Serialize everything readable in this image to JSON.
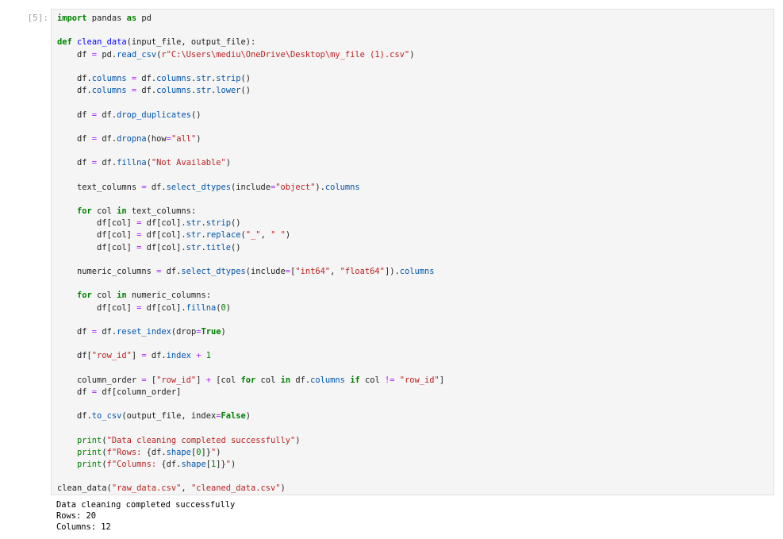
{
  "cell": {
    "prompt": "[5]:",
    "code_lines": [
      [
        {
          "t": "import",
          "c": "kw"
        },
        {
          "t": " pandas "
        },
        {
          "t": "as",
          "c": "kw"
        },
        {
          "t": " pd"
        }
      ],
      [],
      [
        {
          "t": "def",
          "c": "kw"
        },
        {
          "t": " "
        },
        {
          "t": "clean_data",
          "c": "fn"
        },
        {
          "t": "(input_file, output_file):"
        }
      ],
      [
        {
          "t": "    df "
        },
        {
          "t": "=",
          "c": "op"
        },
        {
          "t": " pd."
        },
        {
          "t": "read_csv",
          "c": "attr"
        },
        {
          "t": "("
        },
        {
          "t": "r\"C:\\Users\\mediu\\OneDrive\\Desktop\\my_file (1).csv\"",
          "c": "st"
        },
        {
          "t": ")"
        }
      ],
      [],
      [
        {
          "t": "    df."
        },
        {
          "t": "columns",
          "c": "attr"
        },
        {
          "t": " "
        },
        {
          "t": "=",
          "c": "op"
        },
        {
          "t": " df."
        },
        {
          "t": "columns",
          "c": "attr"
        },
        {
          "t": "."
        },
        {
          "t": "str",
          "c": "attr"
        },
        {
          "t": "."
        },
        {
          "t": "strip",
          "c": "attr"
        },
        {
          "t": "()"
        }
      ],
      [
        {
          "t": "    df."
        },
        {
          "t": "columns",
          "c": "attr"
        },
        {
          "t": " "
        },
        {
          "t": "=",
          "c": "op"
        },
        {
          "t": " df."
        },
        {
          "t": "columns",
          "c": "attr"
        },
        {
          "t": "."
        },
        {
          "t": "str",
          "c": "attr"
        },
        {
          "t": "."
        },
        {
          "t": "lower",
          "c": "attr"
        },
        {
          "t": "()"
        }
      ],
      [],
      [
        {
          "t": "    df "
        },
        {
          "t": "=",
          "c": "op"
        },
        {
          "t": " df."
        },
        {
          "t": "drop_duplicates",
          "c": "attr"
        },
        {
          "t": "()"
        }
      ],
      [],
      [
        {
          "t": "    df "
        },
        {
          "t": "=",
          "c": "op"
        },
        {
          "t": " df."
        },
        {
          "t": "dropna",
          "c": "attr"
        },
        {
          "t": "(how"
        },
        {
          "t": "=",
          "c": "op"
        },
        {
          "t": "\"all\"",
          "c": "st"
        },
        {
          "t": ")"
        }
      ],
      [],
      [
        {
          "t": "    df "
        },
        {
          "t": "=",
          "c": "op"
        },
        {
          "t": " df."
        },
        {
          "t": "fillna",
          "c": "attr"
        },
        {
          "t": "("
        },
        {
          "t": "\"Not Available\"",
          "c": "st"
        },
        {
          "t": ")"
        }
      ],
      [],
      [
        {
          "t": "    text_columns "
        },
        {
          "t": "=",
          "c": "op"
        },
        {
          "t": " df."
        },
        {
          "t": "select_dtypes",
          "c": "attr"
        },
        {
          "t": "(include"
        },
        {
          "t": "=",
          "c": "op"
        },
        {
          "t": "\"object\"",
          "c": "st"
        },
        {
          "t": ")."
        },
        {
          "t": "columns",
          "c": "attr"
        }
      ],
      [],
      [
        {
          "t": "    "
        },
        {
          "t": "for",
          "c": "kw"
        },
        {
          "t": " col "
        },
        {
          "t": "in",
          "c": "kw"
        },
        {
          "t": " text_columns:"
        }
      ],
      [
        {
          "t": "        df[col] "
        },
        {
          "t": "=",
          "c": "op"
        },
        {
          "t": " df[col]."
        },
        {
          "t": "str",
          "c": "attr"
        },
        {
          "t": "."
        },
        {
          "t": "strip",
          "c": "attr"
        },
        {
          "t": "()"
        }
      ],
      [
        {
          "t": "        df[col] "
        },
        {
          "t": "=",
          "c": "op"
        },
        {
          "t": " df[col]."
        },
        {
          "t": "str",
          "c": "attr"
        },
        {
          "t": "."
        },
        {
          "t": "replace",
          "c": "attr"
        },
        {
          "t": "("
        },
        {
          "t": "\"_\"",
          "c": "st"
        },
        {
          "t": ", "
        },
        {
          "t": "\" \"",
          "c": "st"
        },
        {
          "t": ")"
        }
      ],
      [
        {
          "t": "        df[col] "
        },
        {
          "t": "=",
          "c": "op"
        },
        {
          "t": " df[col]."
        },
        {
          "t": "str",
          "c": "attr"
        },
        {
          "t": "."
        },
        {
          "t": "title",
          "c": "attr"
        },
        {
          "t": "()"
        }
      ],
      [],
      [
        {
          "t": "    numeric_columns "
        },
        {
          "t": "=",
          "c": "op"
        },
        {
          "t": " df."
        },
        {
          "t": "select_dtypes",
          "c": "attr"
        },
        {
          "t": "(include"
        },
        {
          "t": "=",
          "c": "op"
        },
        {
          "t": "["
        },
        {
          "t": "\"int64\"",
          "c": "st"
        },
        {
          "t": ", "
        },
        {
          "t": "\"float64\"",
          "c": "st"
        },
        {
          "t": "])."
        },
        {
          "t": "columns",
          "c": "attr"
        }
      ],
      [],
      [
        {
          "t": "    "
        },
        {
          "t": "for",
          "c": "kw"
        },
        {
          "t": " col "
        },
        {
          "t": "in",
          "c": "kw"
        },
        {
          "t": " numeric_columns:"
        }
      ],
      [
        {
          "t": "        df[col] "
        },
        {
          "t": "=",
          "c": "op"
        },
        {
          "t": " df[col]."
        },
        {
          "t": "fillna",
          "c": "attr"
        },
        {
          "t": "("
        },
        {
          "t": "0",
          "c": "nm"
        },
        {
          "t": ")"
        }
      ],
      [],
      [
        {
          "t": "    df "
        },
        {
          "t": "=",
          "c": "op"
        },
        {
          "t": " df."
        },
        {
          "t": "reset_index",
          "c": "attr"
        },
        {
          "t": "(drop"
        },
        {
          "t": "=",
          "c": "op"
        },
        {
          "t": "True",
          "c": "kw"
        },
        {
          "t": ")"
        }
      ],
      [],
      [
        {
          "t": "    df["
        },
        {
          "t": "\"row_id\"",
          "c": "st"
        },
        {
          "t": "] "
        },
        {
          "t": "=",
          "c": "op"
        },
        {
          "t": " df."
        },
        {
          "t": "index",
          "c": "attr"
        },
        {
          "t": " "
        },
        {
          "t": "+",
          "c": "op"
        },
        {
          "t": " "
        },
        {
          "t": "1",
          "c": "nm"
        }
      ],
      [],
      [
        {
          "t": "    column_order "
        },
        {
          "t": "=",
          "c": "op"
        },
        {
          "t": " ["
        },
        {
          "t": "\"row_id\"",
          "c": "st"
        },
        {
          "t": "] "
        },
        {
          "t": "+",
          "c": "op"
        },
        {
          "t": " [col "
        },
        {
          "t": "for",
          "c": "kw"
        },
        {
          "t": " col "
        },
        {
          "t": "in",
          "c": "kw"
        },
        {
          "t": " df."
        },
        {
          "t": "columns",
          "c": "attr"
        },
        {
          "t": " "
        },
        {
          "t": "if",
          "c": "kw"
        },
        {
          "t": " col "
        },
        {
          "t": "!=",
          "c": "op"
        },
        {
          "t": " "
        },
        {
          "t": "\"row_id\"",
          "c": "st"
        },
        {
          "t": "]"
        }
      ],
      [
        {
          "t": "    df "
        },
        {
          "t": "=",
          "c": "op"
        },
        {
          "t": " df[column_order]"
        }
      ],
      [],
      [
        {
          "t": "    df."
        },
        {
          "t": "to_csv",
          "c": "attr"
        },
        {
          "t": "(output_file, index"
        },
        {
          "t": "=",
          "c": "op"
        },
        {
          "t": "False",
          "c": "kw"
        },
        {
          "t": ")"
        }
      ],
      [],
      [
        {
          "t": "    "
        },
        {
          "t": "print",
          "c": "nm"
        },
        {
          "t": "("
        },
        {
          "t": "\"Data cleaning completed successfully\"",
          "c": "st"
        },
        {
          "t": ")"
        }
      ],
      [
        {
          "t": "    "
        },
        {
          "t": "print",
          "c": "nm"
        },
        {
          "t": "("
        },
        {
          "t": "f\"Rows: ",
          "c": "st"
        },
        {
          "t": "{df."
        },
        {
          "t": "shape",
          "c": "attr"
        },
        {
          "t": "["
        },
        {
          "t": "0",
          "c": "nm"
        },
        {
          "t": "]}"
        },
        {
          "t": "\"",
          "c": "st"
        },
        {
          "t": ")"
        }
      ],
      [
        {
          "t": "    "
        },
        {
          "t": "print",
          "c": "nm"
        },
        {
          "t": "("
        },
        {
          "t": "f\"Columns: ",
          "c": "st"
        },
        {
          "t": "{df."
        },
        {
          "t": "shape",
          "c": "attr"
        },
        {
          "t": "["
        },
        {
          "t": "1",
          "c": "nm"
        },
        {
          "t": "]}"
        },
        {
          "t": "\"",
          "c": "st"
        },
        {
          "t": ")"
        }
      ],
      [],
      [
        {
          "t": "clean_data("
        },
        {
          "t": "\"raw_data.csv\"",
          "c": "st"
        },
        {
          "t": ", "
        },
        {
          "t": "\"cleaned_data.csv\"",
          "c": "st"
        },
        {
          "t": ")"
        }
      ]
    ],
    "output_lines": [
      "Data cleaning completed successfully",
      "Rows: 20",
      "Columns: 12"
    ]
  }
}
